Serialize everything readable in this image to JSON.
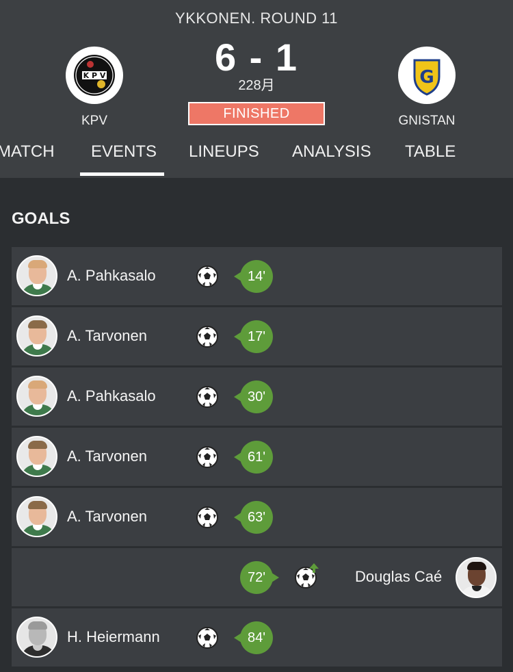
{
  "header": {
    "round": "YKKONEN. ROUND 11",
    "score": "6 - 1",
    "date": "228月",
    "status": "FINISHED",
    "home_team": "KPV",
    "away_team": "GNISTAN"
  },
  "tabs": [
    {
      "label": "MATCH"
    },
    {
      "label": "EVENTS",
      "active": true
    },
    {
      "label": "LINEUPS"
    },
    {
      "label": "ANALYSIS"
    },
    {
      "label": "TABLE"
    }
  ],
  "section": {
    "title": "GOALS"
  },
  "goals": [
    {
      "player": "A. Pahkasalo",
      "minute": "14'",
      "side": "home",
      "icon": "soccer-ball-icon"
    },
    {
      "player": "A. Tarvonen",
      "minute": "17'",
      "side": "home",
      "icon": "soccer-ball-icon"
    },
    {
      "player": "A. Pahkasalo",
      "minute": "30'",
      "side": "home",
      "icon": "soccer-ball-icon"
    },
    {
      "player": "A. Tarvonen",
      "minute": "61'",
      "side": "home",
      "icon": "soccer-ball-icon"
    },
    {
      "player": "A. Tarvonen",
      "minute": "63'",
      "side": "home",
      "icon": "soccer-ball-icon"
    },
    {
      "player": "Douglas Caé",
      "minute": "72'",
      "side": "away",
      "icon": "soccer-ball-icon"
    },
    {
      "player": "H. Heiermann",
      "minute": "84'",
      "side": "home",
      "icon": "soccer-ball-icon"
    }
  ],
  "colors": {
    "header_bg": "#3d4043",
    "body_bg": "#2b2e31",
    "row_bg": "#3b3e42",
    "finished_badge": "#ee7766",
    "minute_bubble": "#5e9c3a"
  }
}
